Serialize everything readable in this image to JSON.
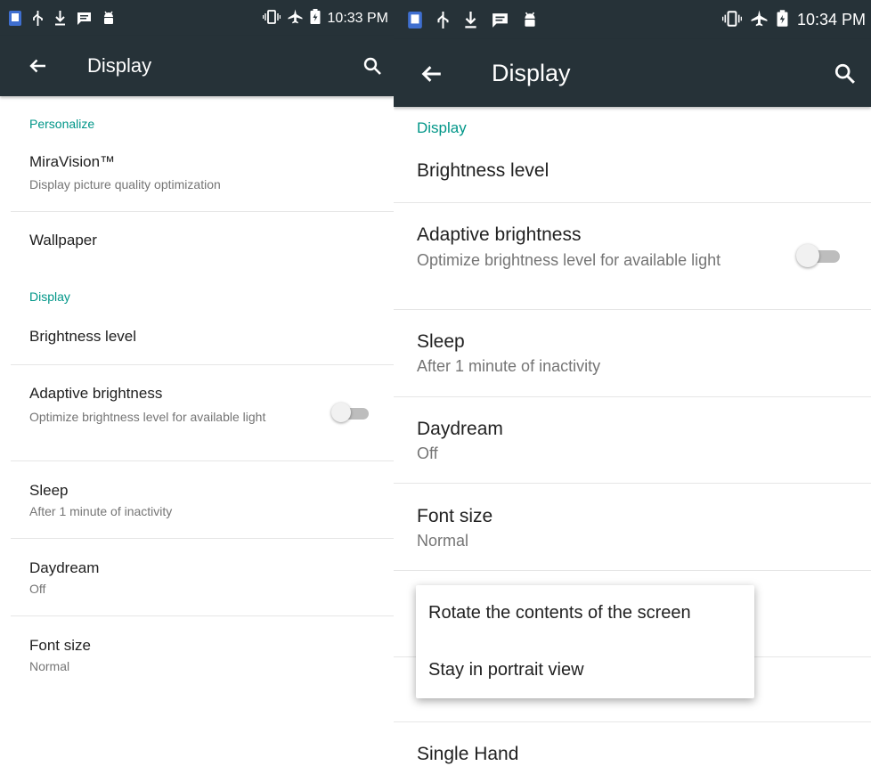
{
  "left": {
    "status": {
      "time": "10:33 PM"
    },
    "toolbar": {
      "title": "Display"
    },
    "sections": {
      "personalize": "Personalize",
      "display": "Display"
    },
    "items": [
      {
        "title": "MiraVision™",
        "summary": "Display picture quality optimization"
      },
      {
        "title": "Wallpaper"
      },
      {
        "title": "Brightness level"
      },
      {
        "title": "Adaptive brightness",
        "summary": "Optimize brightness level for available light",
        "toggle": "off"
      },
      {
        "title": "Sleep",
        "summary": "After 1 minute of inactivity"
      },
      {
        "title": "Daydream",
        "summary": "Off"
      },
      {
        "title": "Font size",
        "summary": "Normal"
      }
    ]
  },
  "right": {
    "status": {
      "time": "10:34 PM"
    },
    "toolbar": {
      "title": "Display"
    },
    "sections": {
      "display": "Display"
    },
    "items": [
      {
        "title": "Brightness level"
      },
      {
        "title": "Adaptive brightness",
        "summary": "Optimize brightness level for available light",
        "toggle": "off"
      },
      {
        "title": "Sleep",
        "summary": "After 1 minute of inactivity"
      },
      {
        "title": "Daydream",
        "summary": "Off"
      },
      {
        "title": "Font size",
        "summary": "Normal"
      },
      {
        "title": "Single Hand"
      }
    ],
    "popup": {
      "options": [
        "Rotate the contents of the screen",
        "Stay in portrait view"
      ]
    }
  },
  "colors": {
    "toolbar": "#263238",
    "accent": "#009688",
    "primary_text": "#212121",
    "secondary_text": "#757575"
  },
  "icons": [
    "notification-icon",
    "usb-icon",
    "download-icon",
    "message-icon",
    "android-icon",
    "vibrate-icon",
    "airplane-icon",
    "battery-icon",
    "back-arrow-icon",
    "search-icon"
  ]
}
